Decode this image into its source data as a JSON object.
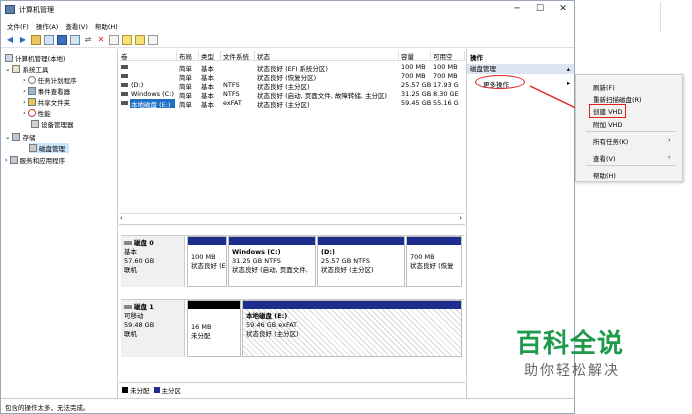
{
  "window": {
    "title": "计算机管理",
    "minimize": "─",
    "maximize": "☐",
    "close": "✕"
  },
  "menubar": [
    "文件(F)",
    "操作(A)",
    "查看(V)",
    "帮助(H)"
  ],
  "tree": [
    {
      "label": "计算机管理(本地)",
      "top": 0
    },
    {
      "label": "系统工具"
    },
    {
      "label": "任务计划程序"
    },
    {
      "label": "事件查看器"
    },
    {
      "label": "共享文件夹"
    },
    {
      "label": "性能"
    },
    {
      "label": "设备管理器"
    },
    {
      "label": "存储"
    },
    {
      "label": "磁盘管理"
    },
    {
      "label": "服务和应用程序"
    }
  ],
  "grid": {
    "headers": [
      "卷",
      "布局",
      "类型",
      "文件系统",
      "状态",
      "容量",
      "可用空"
    ],
    "rows": [
      [
        "",
        "简单",
        "基本",
        "",
        "状态良好 (EFI 系统分区)",
        "100 MB",
        "100 MB"
      ],
      [
        "",
        "简单",
        "基本",
        "",
        "状态良好 (恢复分区)",
        "700 MB",
        "700 MB"
      ],
      [
        "(D:)",
        "简单",
        "基本",
        "NTFS",
        "状态良好 (主分区)",
        "25.57 GB",
        "17.93 G"
      ],
      [
        "Windows (C:)",
        "简单",
        "基本",
        "NTFS",
        "状态良好 (启动, 页面文件, 故障转储, 主分区)",
        "31.25 GB",
        "8.30 GE"
      ],
      [
        "本地磁盘 (E:)",
        "简单",
        "基本",
        "exFAT",
        "状态良好 (主分区)",
        "59.45 GB",
        "55.16 G"
      ]
    ]
  },
  "disk0": {
    "name": "磁盘 0",
    "type": "基本",
    "size": "57.60 GB",
    "state": "联机",
    "parts": [
      {
        "title": "",
        "l1": "100 MB",
        "l2": "状态良好 (E"
      },
      {
        "title": "Windows  (C:)",
        "l1": "31.25 GB NTFS",
        "l2": "状态良好 (启动, 页面文件,"
      },
      {
        "title": "(D:)",
        "l1": "25.57 GB NTFS",
        "l2": "状态良好 (主分区)"
      },
      {
        "title": "",
        "l1": "700 MB",
        "l2": "状态良好 (恢复"
      }
    ]
  },
  "disk1": {
    "name": "磁盘 1",
    "type": "可移动",
    "size": "59.48 GB",
    "state": "联机",
    "parts": [
      {
        "title": "",
        "l1": "16 MB",
        "l2": "未分配"
      },
      {
        "title": "本地磁盘  (E:)",
        "l1": "59.46 GB exFAT",
        "l2": "状态良好 (主分区)"
      }
    ]
  },
  "legend": {
    "unalloc": "未分配",
    "primary": "主分区"
  },
  "actions": {
    "header": "操作",
    "section": "磁盘管理",
    "more": "更多操作"
  },
  "context_menu": [
    "刷新(F)",
    "重新扫描磁盘(R)",
    "创建 VHD",
    "附加 VHD",
    "所有任务(K)",
    "查看(V)",
    "帮助(H)"
  ],
  "status": "包含的操作太多，无法完成。",
  "watermark": {
    "big": "百科全说",
    "small": "助你轻松解决"
  },
  "colors": {
    "primary_partition": "#1e2c8c",
    "unallocated": "#000000",
    "highlight": "#e02020",
    "watermark": "#1e9a4a"
  }
}
